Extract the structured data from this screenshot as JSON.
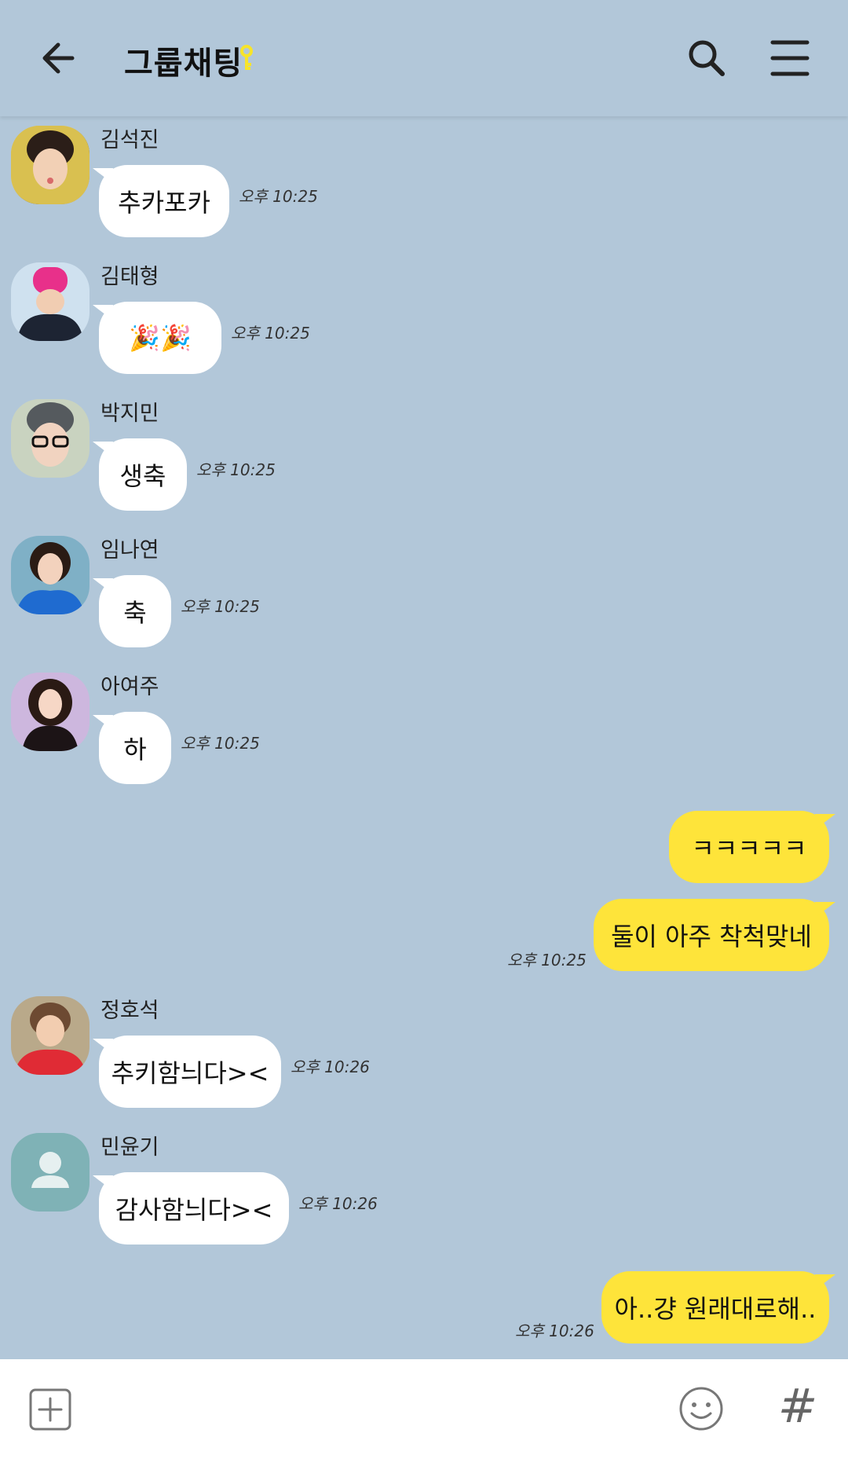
{
  "header": {
    "title": "그룹채팅",
    "back_icon": "arrow-left-icon",
    "title_icon": "key-icon",
    "search_icon": "search-icon",
    "menu_icon": "hamburger-menu-icon",
    "title_icon_color": "#f7e42a"
  },
  "colors": {
    "background": "#b2c7d9",
    "incoming_bubble": "#ffffff",
    "outgoing_bubble": "#fee43a",
    "default_avatar": "#7fb2b6"
  },
  "messages": [
    {
      "sender": "김석진",
      "text": "추카포카",
      "time": "오후 10:25",
      "avatar": "photo"
    },
    {
      "sender": "김태형",
      "text": "🎉🎉",
      "time": "오후 10:25",
      "avatar": "photo"
    },
    {
      "sender": "박지민",
      "text": "생축",
      "time": "오후 10:25",
      "avatar": "photo"
    },
    {
      "sender": "임나연",
      "text": "축",
      "time": "오후 10:25",
      "avatar": "photo"
    },
    {
      "sender": "아여주",
      "text": "하",
      "time": "오후 10:25",
      "avatar": "photo"
    },
    {
      "sender": "me",
      "text": "ㅋㅋㅋㅋㅋ",
      "time": ""
    },
    {
      "sender": "me",
      "text": "둘이 아주 착척맞네",
      "time": "오후 10:25"
    },
    {
      "sender": "정호석",
      "text": "추키함늬다><",
      "time": "오후 10:26",
      "avatar": "photo"
    },
    {
      "sender": "민윤기",
      "text": "감사함늬다><",
      "time": "오후 10:26",
      "avatar": "default-person-icon"
    },
    {
      "sender": "me",
      "text": "아..걍 원래대로해..",
      "time": "오후 10:26"
    }
  ],
  "input": {
    "add_icon": "plus-square-icon",
    "emoji_icon": "smiley-icon",
    "hash_icon": "hash-icon",
    "hash_glyph": "#",
    "placeholder": ""
  }
}
